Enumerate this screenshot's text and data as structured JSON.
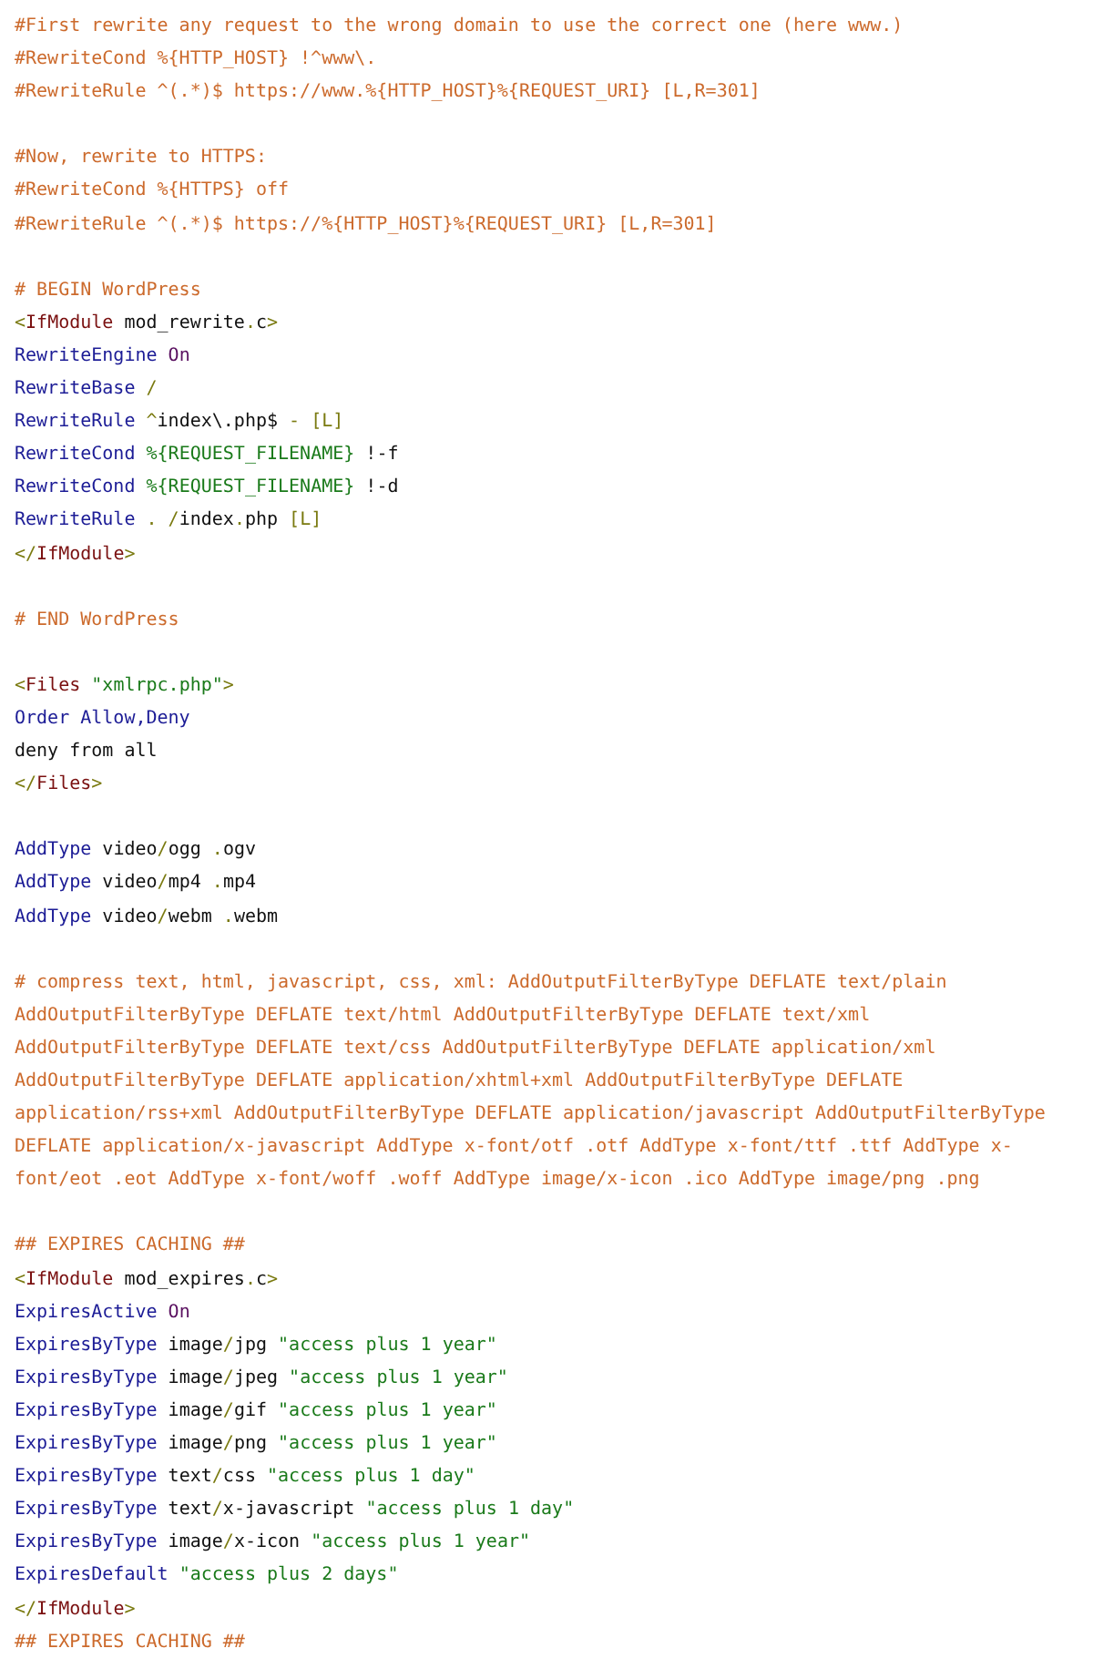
{
  "code_blocks": [
    {
      "lines": [
        {
          "tokens": [
            {
              "kind": "comment",
              "text": "#First rewrite any request to the wrong domain to use the correct one (here www.)"
            }
          ]
        },
        {
          "tokens": [
            {
              "kind": "comment",
              "text": "#RewriteCond %{HTTP_HOST} !^www\\."
            }
          ]
        },
        {
          "tokens": [
            {
              "kind": "comment",
              "text": "#RewriteRule ^(.*)$ https://www.%{HTTP_HOST}%{REQUEST_URI} [L,R=301]"
            }
          ]
        }
      ]
    },
    {
      "lines": [
        {
          "tokens": [
            {
              "kind": "comment",
              "text": "#Now, rewrite to HTTPS:"
            }
          ]
        },
        {
          "tokens": [
            {
              "kind": "comment",
              "text": "#RewriteCond %{HTTPS} off"
            }
          ]
        },
        {
          "tokens": [
            {
              "kind": "comment",
              "text": "#RewriteRule ^(.*)$ https://%{HTTP_HOST}%{REQUEST_URI} [L,R=301]"
            }
          ]
        }
      ]
    },
    {
      "lines": [
        {
          "tokens": [
            {
              "kind": "comment",
              "text": "# BEGIN WordPress"
            }
          ]
        },
        {
          "tokens": [
            {
              "kind": "punct",
              "text": "<"
            },
            {
              "kind": "tag",
              "text": "IfModule"
            },
            {
              "kind": "plain",
              "text": " mod_rewrite"
            },
            {
              "kind": "punct",
              "text": "."
            },
            {
              "kind": "plain",
              "text": "c"
            },
            {
              "kind": "punct",
              "text": ">"
            }
          ]
        },
        {
          "tokens": [
            {
              "kind": "directive",
              "text": "RewriteEngine"
            },
            {
              "kind": "keyword",
              "text": " On"
            }
          ]
        },
        {
          "tokens": [
            {
              "kind": "directive",
              "text": "RewriteBase"
            },
            {
              "kind": "punct",
              "text": " /"
            }
          ]
        },
        {
          "tokens": [
            {
              "kind": "directive",
              "text": "RewriteRule"
            },
            {
              "kind": "punct",
              "text": " ^"
            },
            {
              "kind": "plain",
              "text": "index\\.php$"
            },
            {
              "kind": "punct",
              "text": " - [L]"
            }
          ]
        },
        {
          "tokens": [
            {
              "kind": "directive",
              "text": "RewriteCond"
            },
            {
              "kind": "string",
              "text": " %{REQUEST_FILENAME}"
            },
            {
              "kind": "plain",
              "text": " !-f"
            }
          ]
        },
        {
          "tokens": [
            {
              "kind": "directive",
              "text": "RewriteCond"
            },
            {
              "kind": "string",
              "text": " %{REQUEST_FILENAME}"
            },
            {
              "kind": "plain",
              "text": " !-d"
            }
          ]
        },
        {
          "tokens": [
            {
              "kind": "directive",
              "text": "RewriteRule"
            },
            {
              "kind": "punct",
              "text": " . /"
            },
            {
              "kind": "plain",
              "text": "index"
            },
            {
              "kind": "punct",
              "text": "."
            },
            {
              "kind": "plain",
              "text": "php"
            },
            {
              "kind": "punct",
              "text": " [L]"
            }
          ]
        },
        {
          "tokens": [
            {
              "kind": "punct",
              "text": "</"
            },
            {
              "kind": "tag",
              "text": "IfModule"
            },
            {
              "kind": "punct",
              "text": ">"
            }
          ]
        }
      ]
    },
    {
      "lines": [
        {
          "tokens": [
            {
              "kind": "comment",
              "text": "# END WordPress"
            }
          ]
        }
      ]
    },
    {
      "lines": [
        {
          "tokens": [
            {
              "kind": "punct",
              "text": "<"
            },
            {
              "kind": "tag",
              "text": "Files"
            },
            {
              "kind": "string",
              "text": " \"xmlrpc.php\""
            },
            {
              "kind": "punct",
              "text": ">"
            }
          ]
        },
        {
          "tokens": [
            {
              "kind": "directive",
              "text": "Order Allow,Deny"
            }
          ]
        },
        {
          "tokens": [
            {
              "kind": "plain",
              "text": "deny from all"
            }
          ]
        },
        {
          "tokens": [
            {
              "kind": "punct",
              "text": "</"
            },
            {
              "kind": "tag",
              "text": "Files"
            },
            {
              "kind": "punct",
              "text": ">"
            }
          ]
        }
      ]
    },
    {
      "lines": [
        {
          "tokens": [
            {
              "kind": "directive",
              "text": "AddType"
            },
            {
              "kind": "plain",
              "text": " video"
            },
            {
              "kind": "punct",
              "text": "/"
            },
            {
              "kind": "plain",
              "text": "ogg "
            },
            {
              "kind": "punct",
              "text": "."
            },
            {
              "kind": "plain",
              "text": "ogv"
            }
          ]
        },
        {
          "tokens": [
            {
              "kind": "directive",
              "text": "AddType"
            },
            {
              "kind": "plain",
              "text": " video"
            },
            {
              "kind": "punct",
              "text": "/"
            },
            {
              "kind": "plain",
              "text": "mp4 "
            },
            {
              "kind": "punct",
              "text": "."
            },
            {
              "kind": "plain",
              "text": "mp4"
            }
          ]
        },
        {
          "tokens": [
            {
              "kind": "directive",
              "text": "AddType"
            },
            {
              "kind": "plain",
              "text": " video"
            },
            {
              "kind": "punct",
              "text": "/"
            },
            {
              "kind": "plain",
              "text": "webm "
            },
            {
              "kind": "punct",
              "text": "."
            },
            {
              "kind": "plain",
              "text": "webm"
            }
          ]
        }
      ]
    },
    {
      "lines": [
        {
          "tokens": [
            {
              "kind": "comment",
              "text": "# compress text, html, javascript, css, xml: AddOutputFilterByType DEFLATE text/plain"
            }
          ]
        },
        {
          "tokens": [
            {
              "kind": "comment",
              "text": "AddOutputFilterByType DEFLATE text/html AddOutputFilterByType DEFLATE text/xml"
            }
          ]
        },
        {
          "tokens": [
            {
              "kind": "comment",
              "text": "AddOutputFilterByType DEFLATE text/css AddOutputFilterByType DEFLATE application/xml"
            }
          ]
        },
        {
          "tokens": [
            {
              "kind": "comment",
              "text": "AddOutputFilterByType DEFLATE application/xhtml+xml AddOutputFilterByType DEFLATE"
            }
          ]
        },
        {
          "tokens": [
            {
              "kind": "comment",
              "text": "application/rss+xml AddOutputFilterByType DEFLATE application/javascript AddOutputFilterByType"
            }
          ]
        },
        {
          "tokens": [
            {
              "kind": "comment",
              "text": "DEFLATE application/x-javascript AddType x-font/otf .otf AddType x-font/ttf .ttf AddType x-"
            }
          ]
        },
        {
          "tokens": [
            {
              "kind": "comment",
              "text": "font/eot .eot AddType x-font/woff .woff AddType image/x-icon .ico AddType image/png .png"
            }
          ]
        }
      ]
    },
    {
      "lines": [
        {
          "tokens": [
            {
              "kind": "comment",
              "text": "## EXPIRES CACHING ##"
            }
          ]
        },
        {
          "tokens": [
            {
              "kind": "punct",
              "text": "<"
            },
            {
              "kind": "tag",
              "text": "IfModule"
            },
            {
              "kind": "plain",
              "text": " mod_expires"
            },
            {
              "kind": "punct",
              "text": "."
            },
            {
              "kind": "plain",
              "text": "c"
            },
            {
              "kind": "punct",
              "text": ">"
            }
          ]
        },
        {
          "tokens": [
            {
              "kind": "directive",
              "text": "ExpiresActive"
            },
            {
              "kind": "keyword",
              "text": " On"
            }
          ]
        },
        {
          "tokens": [
            {
              "kind": "directive",
              "text": "ExpiresByType"
            },
            {
              "kind": "plain",
              "text": " image"
            },
            {
              "kind": "punct",
              "text": "/"
            },
            {
              "kind": "plain",
              "text": "jpg "
            },
            {
              "kind": "string",
              "text": "\"access plus 1 year\""
            }
          ]
        },
        {
          "tokens": [
            {
              "kind": "directive",
              "text": "ExpiresByType"
            },
            {
              "kind": "plain",
              "text": " image"
            },
            {
              "kind": "punct",
              "text": "/"
            },
            {
              "kind": "plain",
              "text": "jpeg "
            },
            {
              "kind": "string",
              "text": "\"access plus 1 year\""
            }
          ]
        },
        {
          "tokens": [
            {
              "kind": "directive",
              "text": "ExpiresByType"
            },
            {
              "kind": "plain",
              "text": " image"
            },
            {
              "kind": "punct",
              "text": "/"
            },
            {
              "kind": "plain",
              "text": "gif "
            },
            {
              "kind": "string",
              "text": "\"access plus 1 year\""
            }
          ]
        },
        {
          "tokens": [
            {
              "kind": "directive",
              "text": "ExpiresByType"
            },
            {
              "kind": "plain",
              "text": " image"
            },
            {
              "kind": "punct",
              "text": "/"
            },
            {
              "kind": "plain",
              "text": "png "
            },
            {
              "kind": "string",
              "text": "\"access plus 1 year\""
            }
          ]
        },
        {
          "tokens": [
            {
              "kind": "directive",
              "text": "ExpiresByType"
            },
            {
              "kind": "plain",
              "text": " text"
            },
            {
              "kind": "punct",
              "text": "/"
            },
            {
              "kind": "plain",
              "text": "css "
            },
            {
              "kind": "string",
              "text": "\"access plus 1 day\""
            }
          ]
        },
        {
          "tokens": [
            {
              "kind": "directive",
              "text": "ExpiresByType"
            },
            {
              "kind": "plain",
              "text": " text"
            },
            {
              "kind": "punct",
              "text": "/"
            },
            {
              "kind": "plain",
              "text": "x-javascript "
            },
            {
              "kind": "string",
              "text": "\"access plus 1 day\""
            }
          ]
        },
        {
          "tokens": [
            {
              "kind": "directive",
              "text": "ExpiresByType"
            },
            {
              "kind": "plain",
              "text": " image"
            },
            {
              "kind": "punct",
              "text": "/"
            },
            {
              "kind": "plain",
              "text": "x-icon "
            },
            {
              "kind": "string",
              "text": "\"access plus 1 year\""
            }
          ]
        },
        {
          "tokens": [
            {
              "kind": "directive",
              "text": "ExpiresDefault"
            },
            {
              "kind": "string",
              "text": " \"access plus 2 days\""
            }
          ]
        },
        {
          "tokens": [
            {
              "kind": "punct",
              "text": "</"
            },
            {
              "kind": "tag",
              "text": "IfModule"
            },
            {
              "kind": "punct",
              "text": ">"
            }
          ]
        },
        {
          "tokens": [
            {
              "kind": "comment",
              "text": "## EXPIRES CACHING ##"
            }
          ]
        }
      ]
    }
  ]
}
